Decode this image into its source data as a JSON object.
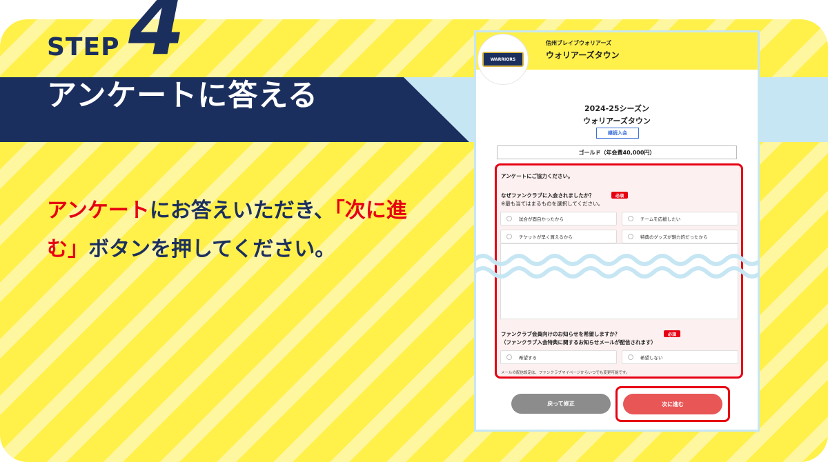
{
  "step": {
    "word": "STEP",
    "number": "4",
    "title": "アンケートに答える"
  },
  "instruction": {
    "red1": "アンケート",
    "text1": "にお答えいただき、",
    "red2": "「次に進む」",
    "text2": "ボタンを押してください。"
  },
  "phone": {
    "logo_text": "WARRIORS",
    "club_small": "信州ブレイブウォリアーズ",
    "club_big": "ウォリアーズタウン",
    "season": "2024-25シーズン",
    "membership": "ウォリアーズタウン",
    "renew_label": "継続入会",
    "plan": "ゴールド（年会費40,000円）",
    "survey": {
      "heading": "アンケートにご協力ください。",
      "q1": "なぜファンクラブに入会されましたか？",
      "q1_note": "※最も当てはまるものを選択してください。",
      "required": "必須",
      "options": [
        "試合が面白かったから",
        "チームを応援したい",
        "チケットが早く買えるから",
        "特典のグッズが魅力的だったから"
      ],
      "q2": "ファンクラブ会員向けのお知らせを希望しますか？",
      "q2_note": "（ファンクラブ入会特典に関するお知らせメールが配信されます）",
      "q2_options": [
        "希望する",
        "希望しない"
      ],
      "mail_note": "メールの配信設定は、ファンクラブマイページからいつでも変更可能です。"
    },
    "back_button": "戻って修正",
    "next_button": "次に進む"
  },
  "colors": {
    "navy": "#1b2f5e",
    "red": "#e60012",
    "yellow": "#fff04a",
    "light_blue": "#c7e6f3"
  }
}
